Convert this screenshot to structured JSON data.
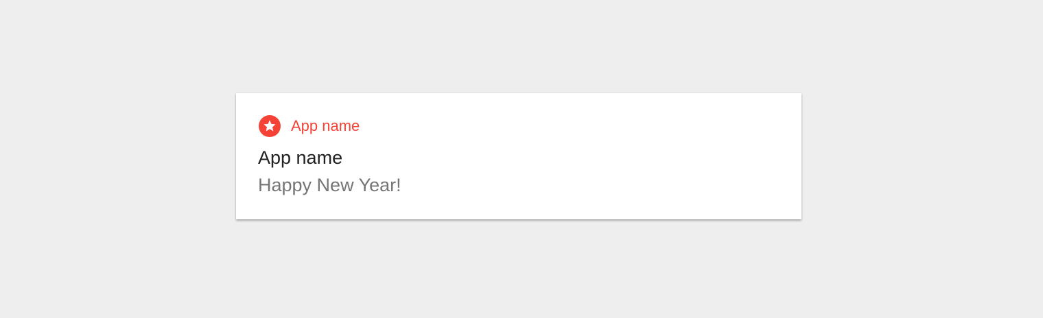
{
  "accent_color": "#f44336",
  "notification": {
    "header": {
      "icon": "star-icon",
      "app_name": "App name"
    },
    "title": "App name",
    "message": "Happy New Year!"
  }
}
